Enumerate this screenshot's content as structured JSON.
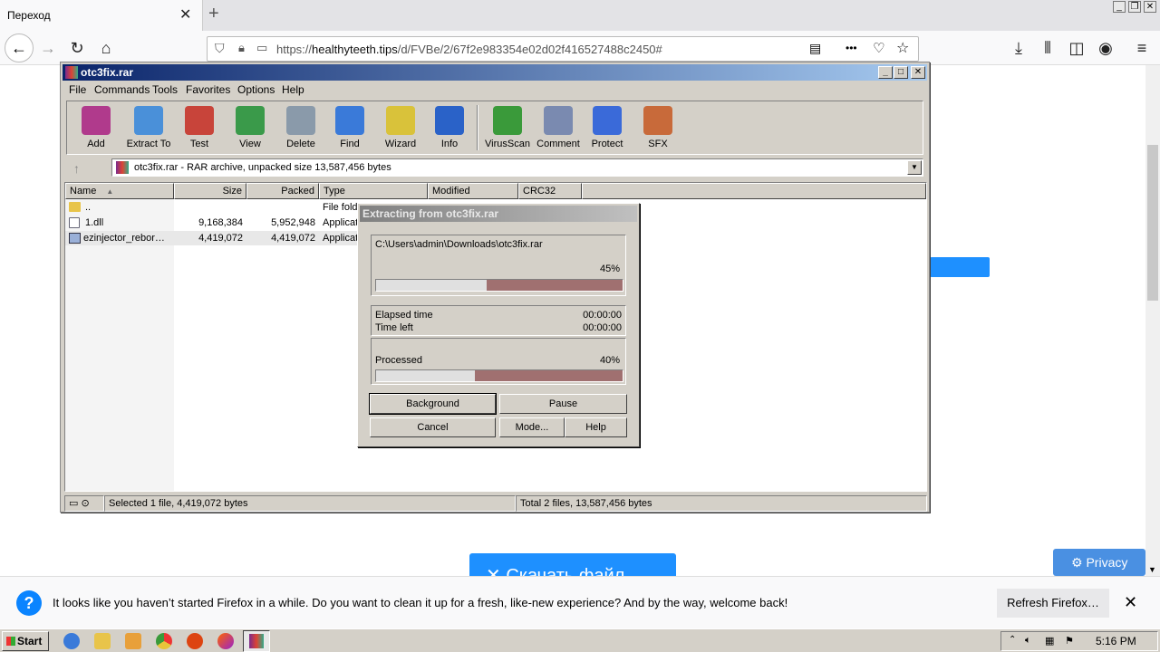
{
  "browser": {
    "tab_title": "Переход",
    "tab_close": "✕",
    "new_tab": "+",
    "url_prefix": "https://",
    "url_domain": "healthyteeth.tips",
    "url_path": "/d/FVBe/2/67f2e983354e02d02f416527488c2450#",
    "menu_dots": "•••"
  },
  "page": {
    "download_button": "✕ Скачать файл",
    "privacy_button": "Privacy"
  },
  "notification": {
    "text": "It looks like you haven’t started Firefox in a while. Do you want to clean it up for a fresh, like-new experience? And by the way, welcome back!",
    "refresh_button": "Refresh Firefox…",
    "close": "✕",
    "icon_glyph": "?"
  },
  "winrar": {
    "title": "otc3fix.rar",
    "menu": [
      "File",
      "Commands",
      "Tools",
      "Favorites",
      "Options",
      "Help"
    ],
    "toolbar": [
      {
        "label": "Add",
        "icon": "add-archive-icon",
        "color": "#b03a8c"
      },
      {
        "label": "Extract To",
        "icon": "extract-folder-icon",
        "color": "#4a90d9"
      },
      {
        "label": "Test",
        "icon": "test-clipboard-icon",
        "color": "#c8443a"
      },
      {
        "label": "View",
        "icon": "view-book-icon",
        "color": "#3a9a4a"
      },
      {
        "label": "Delete",
        "icon": "trash-icon",
        "color": "#8a9aaa"
      },
      {
        "label": "Find",
        "icon": "magnifier-icon",
        "color": "#3a7ad9"
      },
      {
        "label": "Wizard",
        "icon": "wand-icon",
        "color": "#d9c23a"
      },
      {
        "label": "Info",
        "icon": "info-icon",
        "color": "#2a62c8"
      },
      {
        "label": "VirusScan",
        "icon": "virus-icon",
        "color": "#3a9a3a"
      },
      {
        "label": "Comment",
        "icon": "comment-icon",
        "color": "#7a8ab0"
      },
      {
        "label": "Protect",
        "icon": "shield-icon",
        "color": "#3a6ad9"
      },
      {
        "label": "SFX",
        "icon": "sfx-box-icon",
        "color": "#c86a3a"
      }
    ],
    "path": "otc3fix.rar - RAR archive, unpacked size 13,587,456 bytes",
    "columns": [
      "Name",
      "Size",
      "Packed",
      "Type",
      "Modified",
      "CRC32"
    ],
    "rows": [
      {
        "name": "..",
        "size": "",
        "packed": "",
        "type": "File fold"
      },
      {
        "name": "1.dll",
        "size": "9,168,384",
        "packed": "5,952,948",
        "type": "Applicat"
      },
      {
        "name": "ezinjector_rebor…",
        "size": "4,419,072",
        "packed": "4,419,072",
        "type": "Applicat"
      }
    ],
    "status_left": "Selected 1 file, 4,419,072 bytes",
    "status_right": "Total 2 files, 13,587,456 bytes"
  },
  "extract_dialog": {
    "title": "Extracting from otc3fix.rar",
    "path": "C:\\Users\\admin\\Downloads\\otc3fix.rar",
    "file_percent_label": "45%",
    "file_progress": 0.45,
    "elapsed_label": "Elapsed time",
    "elapsed_value": "00:00:00",
    "left_label": "Time left",
    "left_value": "00:00:00",
    "processed_label": "Processed",
    "processed_percent_label": "40%",
    "processed_progress": 0.4,
    "buttons": {
      "background": "Background",
      "pause": "Pause",
      "cancel": "Cancel",
      "mode": "Mode...",
      "help": "Help"
    }
  },
  "taskbar": {
    "start": "Start",
    "clock": "5:16 PM"
  }
}
